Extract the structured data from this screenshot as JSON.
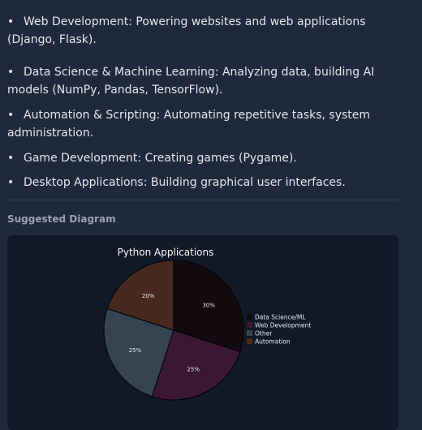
{
  "list": [
    {
      "text": "Web Development: Powering websites and web applications (Django, Flask)."
    },
    {
      "text": "Data Science & Machine Learning: Analyzing data, building AI models (NumPy, Pandas, TensorFlow)."
    },
    {
      "text": "Automation & Scripting: Automating repetitive tasks, system administration."
    },
    {
      "text": "Game Development: Creating games (Pygame)."
    },
    {
      "text": "Desktop Applications: Building graphical user interfaces."
    }
  ],
  "bullet": "•",
  "section_label": "Suggested Diagram",
  "colors": {
    "background": "#1e293b",
    "panel": "#111827",
    "divider": "#374151"
  },
  "chart_data": {
    "type": "pie",
    "title": "Python Applications",
    "legend_position": "right",
    "slices": [
      {
        "label": "Data Science/ML",
        "value": 30,
        "display": "30%",
        "color": "#120a0e"
      },
      {
        "label": "Web Development",
        "value": 25,
        "display": "25%",
        "color": "#3b1733"
      },
      {
        "label": "Other",
        "value": 25,
        "display": "25%",
        "color": "#344451"
      },
      {
        "label": "Automation",
        "value": 20,
        "display": "20%",
        "color": "#48291f"
      }
    ]
  }
}
